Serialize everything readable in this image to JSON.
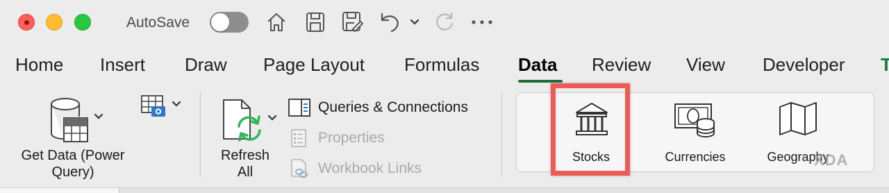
{
  "titlebar": {
    "autosave_label": "AutoSave",
    "autosave_on": false,
    "icons": [
      "home-icon",
      "save-icon",
      "save-as-icon",
      "undo-icon",
      "chevron-down-icon",
      "redo-icon",
      "more-icon"
    ]
  },
  "tabs": [
    {
      "label": "Home",
      "active": false
    },
    {
      "label": "Insert",
      "active": false
    },
    {
      "label": "Draw",
      "active": false
    },
    {
      "label": "Page Layout",
      "active": false
    },
    {
      "label": "Formulas",
      "active": false
    },
    {
      "label": "Data",
      "active": true
    },
    {
      "label": "Review",
      "active": false
    },
    {
      "label": "View",
      "active": false
    },
    {
      "label": "Developer",
      "active": false
    }
  ],
  "tab_overflow_char": "T",
  "get_data": {
    "label_line1": "Get Data (Power",
    "label_line2": "Query)"
  },
  "refresh": {
    "label_line1": "Refresh",
    "label_line2": "All"
  },
  "queries": {
    "queries_connections": "Queries & Connections",
    "properties": "Properties",
    "workbook_links": "Workbook Links"
  },
  "data_types": {
    "stocks": "Stocks",
    "currencies": "Currencies",
    "geography": "Geography"
  },
  "watermark": "XDA",
  "colors": {
    "accent": "#1e6e3c",
    "highlight": "#f05a55",
    "refresh_green": "#2fb457",
    "camera_blue": "#2a78c8"
  }
}
